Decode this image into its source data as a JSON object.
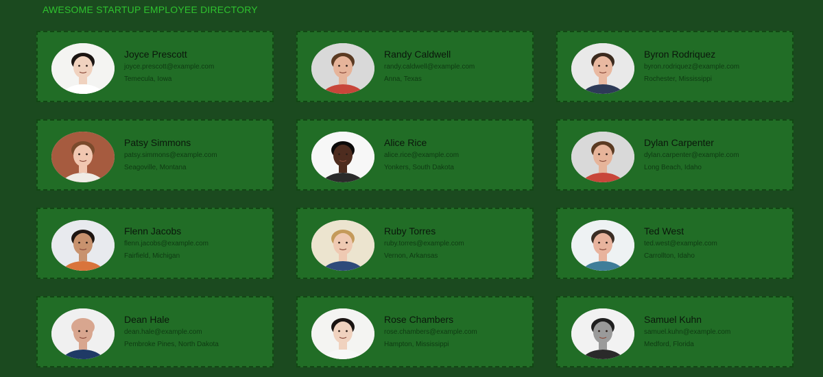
{
  "header": {
    "title": "AWESOME STARTUP EMPLOYEE DIRECTORY"
  },
  "colors": {
    "page_background": "#1b4a1f",
    "card_background": "#216d26",
    "card_border": "#124714",
    "header_text": "#2fc22f"
  },
  "employees": [
    {
      "name": "Joyce Prescott",
      "email": "joyce.prescott@example.com",
      "location": "Temecula, Iowa",
      "photo": {
        "bg": "#f4f4f2",
        "skin": "#f0d2bf",
        "hair": "#1a1412",
        "shirt": "#ffffff"
      }
    },
    {
      "name": "Randy Caldwell",
      "email": "randy.caldwell@example.com",
      "location": "Anna, Texas",
      "photo": {
        "bg": "#d9d9d9",
        "skin": "#e6b49a",
        "hair": "#5a3a22",
        "shirt": "#c8463a"
      }
    },
    {
      "name": "Byron Rodriquez",
      "email": "byron.rodriquez@example.com",
      "location": "Rochester, Mississippi",
      "photo": {
        "bg": "#e9e9e9",
        "skin": "#e9b9a1",
        "hair": "#3b2a1e",
        "shirt": "#2d3a57"
      }
    },
    {
      "name": "Patsy Simmons",
      "email": "patsy.simmons@example.com",
      "location": "Seagoville, Montana",
      "photo": {
        "bg": "#a65b3f",
        "skin": "#f1c7b1",
        "hair": "#7a4a2c",
        "shirt": "#f0ece6"
      }
    },
    {
      "name": "Alice Rice",
      "email": "alice.rice@example.com",
      "location": "Yonkers, South Dakota",
      "photo": {
        "bg": "#f7f7f7",
        "skin": "#4e2c1f",
        "hair": "#0c0a0a",
        "shirt": "#2a2a2a"
      }
    },
    {
      "name": "Dylan Carpenter",
      "email": "dylan.carpenter@example.com",
      "location": "Long Beach, Idaho",
      "photo": {
        "bg": "#d9d9d9",
        "skin": "#e6b49a",
        "hair": "#5a3a22",
        "shirt": "#c8463a"
      }
    },
    {
      "name": "Flenn Jacobs",
      "email": "flenn.jacobs@example.com",
      "location": "Fairfield, Michigan",
      "photo": {
        "bg": "#e8eaee",
        "skin": "#c8926e",
        "hair": "#1d1511",
        "shirt": "#d9743c"
      }
    },
    {
      "name": "Ruby Torres",
      "email": "ruby.torres@example.com",
      "location": "Vernon, Arkansas",
      "photo": {
        "bg": "#ece4cf",
        "skin": "#efc9b2",
        "hair": "#c49a5a",
        "shirt": "#2e4a7a"
      }
    },
    {
      "name": "Ted West",
      "email": "ted.west@example.com",
      "location": "Carrollton, Idaho",
      "photo": {
        "bg": "#eef2f3",
        "skin": "#e8b39d",
        "hair": "#3a2d24",
        "shirt": "#3f7d99"
      }
    },
    {
      "name": "Dean Hale",
      "email": "dean.hale@example.com",
      "location": "Pembroke Pines, North Dakota",
      "photo": {
        "bg": "#f0f0f0",
        "skin": "#d8a68f",
        "hair": "#d8a68f",
        "shirt": "#1f3a66"
      }
    },
    {
      "name": "Rose Chambers",
      "email": "rose.chambers@example.com",
      "location": "Hampton, Mississippi",
      "photo": {
        "bg": "#f4f4f2",
        "skin": "#f0d2bf",
        "hair": "#1a1412",
        "shirt": "#f7f7f7"
      }
    },
    {
      "name": "Samuel Kuhn",
      "email": "samuel.kuhn@example.com",
      "location": "Medford, Florida",
      "photo": {
        "bg": "#f2f2f2",
        "skin": "#9a9a9a",
        "hair": "#1f1f1f",
        "shirt": "#2a2a2a"
      }
    }
  ]
}
